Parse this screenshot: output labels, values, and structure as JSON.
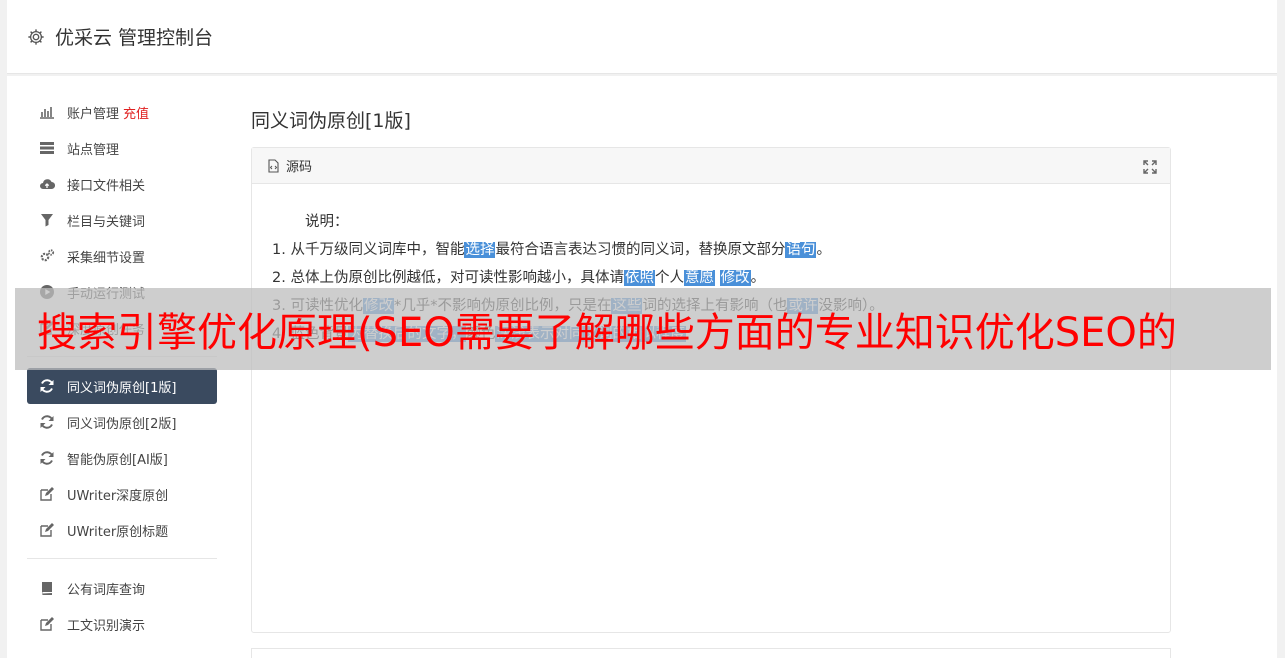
{
  "header": {
    "title": "优采云 管理控制台",
    "icon": "gear-icon"
  },
  "sidebar": {
    "group1": [
      {
        "label": "账户管理",
        "badge": "充值",
        "icon": "bar-chart-icon"
      },
      {
        "label": "站点管理",
        "icon": "server-icon"
      },
      {
        "label": "接口文件相关",
        "icon": "cloud-upload-icon"
      },
      {
        "label": "栏目与关键词",
        "icon": "filter-icon"
      },
      {
        "label": "采集细节设置",
        "icon": "gears-icon"
      },
      {
        "label": "手动运行测试",
        "icon": "play-icon"
      },
      {
        "label": "深度原创任务",
        "icon": "edit-icon"
      }
    ],
    "group2": [
      {
        "label": "同义词伪原创[1版]",
        "icon": "refresh-icon",
        "active": true
      },
      {
        "label": "同义词伪原创[2版]",
        "icon": "refresh-icon"
      },
      {
        "label": "智能伪原创[AI版]",
        "icon": "refresh-icon"
      },
      {
        "label": "UWriter深度原创",
        "icon": "edit-icon"
      },
      {
        "label": "UWriter原创标题",
        "icon": "edit-icon"
      }
    ],
    "group3": [
      {
        "label": "公有词库查询",
        "icon": "book-icon"
      },
      {
        "label": "工文识别演示",
        "icon": "edit-icon"
      }
    ]
  },
  "content": {
    "page_title": "同义词伪原创[1版]",
    "panel_title": "源码",
    "intro": "说明：",
    "lines": [
      {
        "parts": [
          "1. 从千万级同义词库中，智能",
          "选择",
          "最符合语言表达习惯的同义词，替换原文部分",
          "语句",
          "。"
        ]
      },
      {
        "parts": [
          "2. 总体上伪原创比例越低，对可读性影响越小，具体请",
          "依照",
          "个人",
          "意愿",
          " ",
          "修改",
          "。"
        ]
      },
      {
        "parts": [
          "3. 可读性优化",
          "修改",
          "*几乎*不影响伪原创比例，只是在",
          "这些",
          "词的选择上有影响（也",
          "或许",
          "没影响）。"
        ]
      },
      {
        "parts": [
          "4. 蓝色背景",
          "为替换后的文字，",
          "颜色",
          "深浅表示对同义词的相似程度"
        ]
      }
    ]
  },
  "overlay": {
    "text": "搜索引擎优化原理(SEO需要了解哪些方面的专业知识优化SEO的"
  },
  "colors": {
    "active_bg": "#3a4a5f",
    "highlight": "#4a90d9",
    "overlay_text": "#ff0000",
    "recharge": "#e02020"
  }
}
